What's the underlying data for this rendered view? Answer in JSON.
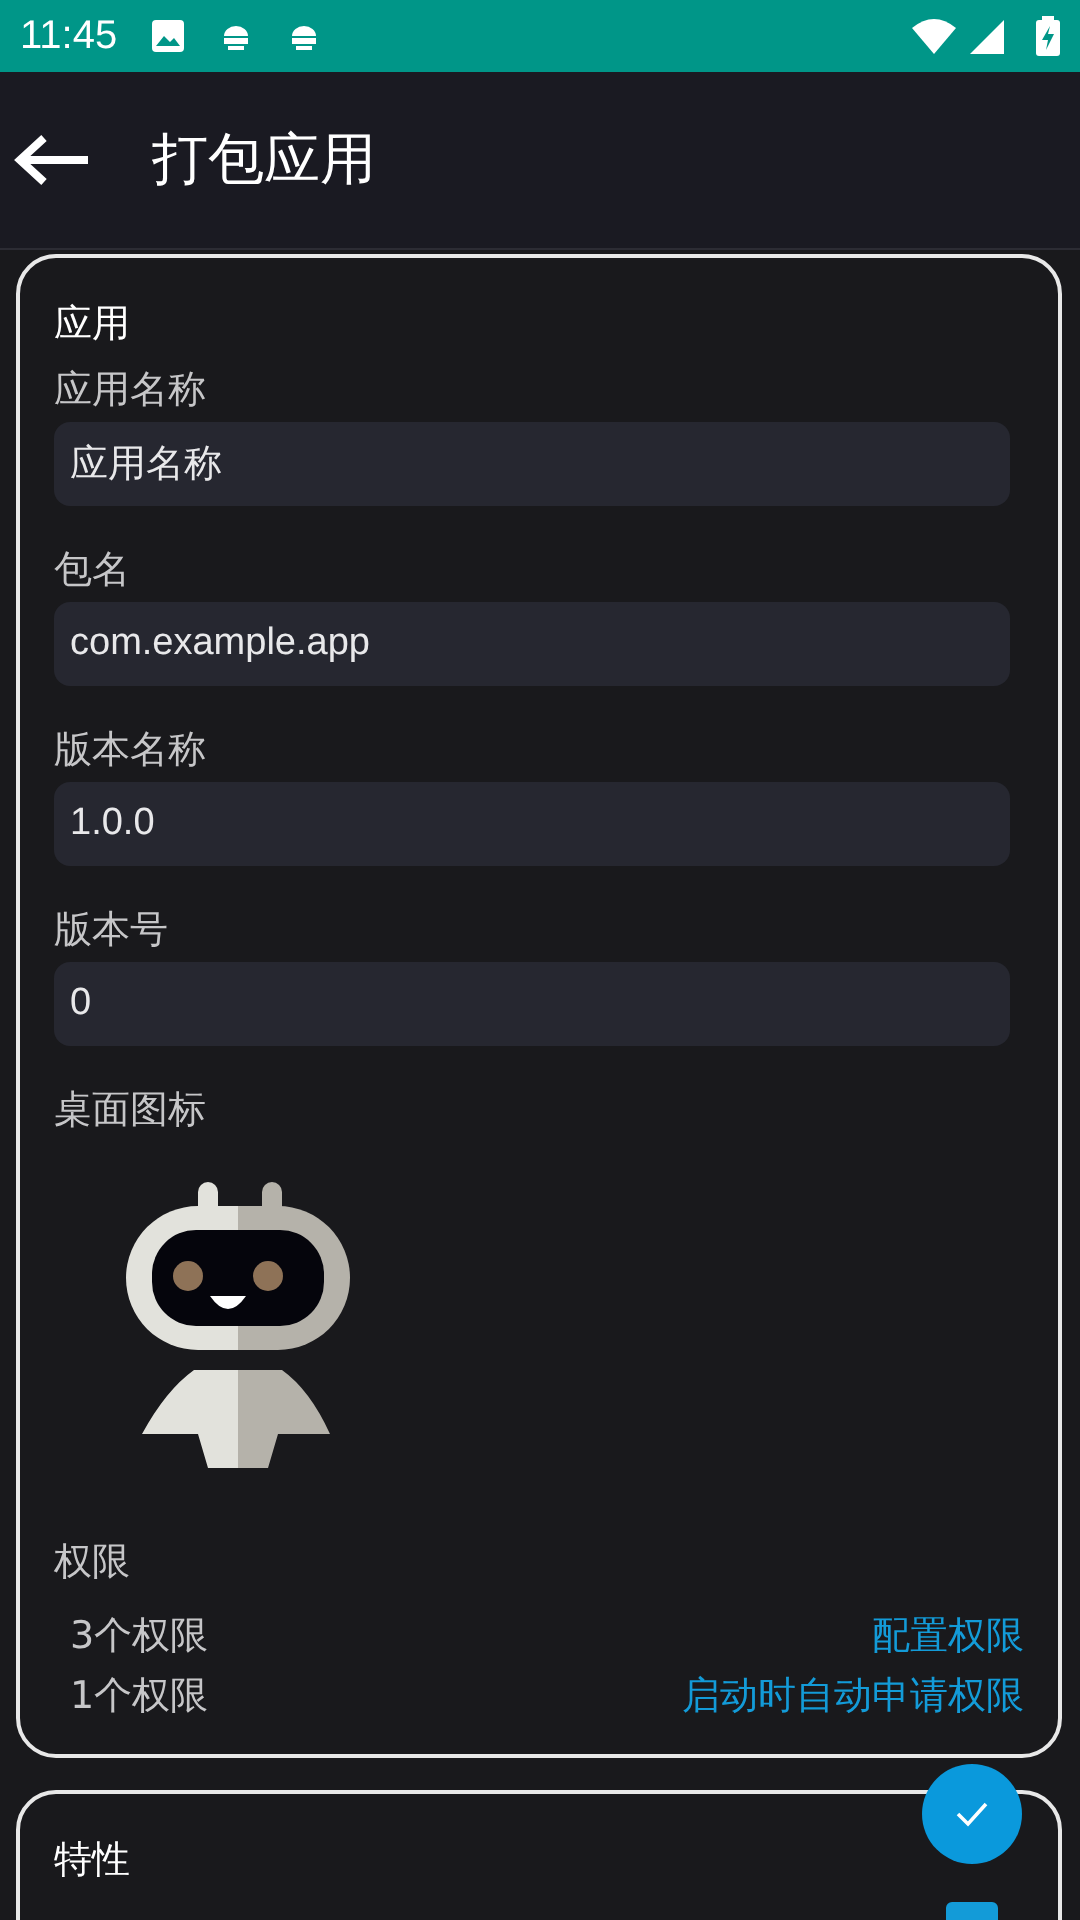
{
  "status_bar": {
    "time": "11:45"
  },
  "app_bar": {
    "title": "打包应用"
  },
  "app_section": {
    "title": "应用",
    "fields": [
      {
        "label": "应用名称",
        "value": "应用名称"
      },
      {
        "label": "包名",
        "value": "com.example.app"
      },
      {
        "label": "版本名称",
        "value": "1.0.0"
      },
      {
        "label": "版本号",
        "value": "0"
      }
    ],
    "icon_label": "桌面图标",
    "permissions_label": "权限",
    "permissions": [
      {
        "count": "3个权限",
        "action": "配置权限"
      },
      {
        "count": "1个权限",
        "action": "启动时自动申请权限"
      }
    ]
  },
  "features_section": {
    "title": "特性",
    "checkbox": {
      "checked": true
    }
  }
}
